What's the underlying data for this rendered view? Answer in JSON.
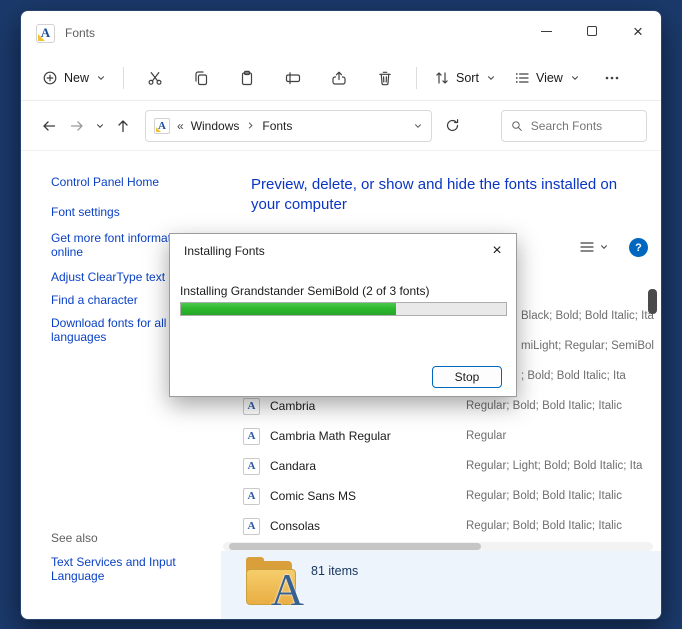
{
  "colors": {
    "desktop_bg": "#1b3a6c",
    "accent_blue": "#0067c0",
    "link_blue": "#0a41c4",
    "heading_blue": "#0a34c4",
    "progress_green": "#2db82d"
  },
  "window": {
    "title": "Fonts"
  },
  "toolbar": {
    "new_label": "New",
    "sort_label": "Sort",
    "view_label": "View"
  },
  "address_bar": {
    "breadcrumb_prefix": "«",
    "crumbs": [
      "Windows",
      "Fonts"
    ],
    "search_placeholder": "Search Fonts"
  },
  "sidebar": {
    "links": [
      "Control Panel Home",
      "Font settings",
      "Get more font information online",
      "Adjust ClearType text",
      "Find a character",
      "Download fonts for all languages"
    ],
    "see_also_label": "See also",
    "see_also_links": [
      "Text Services and Input Language"
    ]
  },
  "main": {
    "heading": "Preview, delete, or show and hide the fonts installed on your computer",
    "font_list": [
      {
        "name": "",
        "styles": "Black; Bold; Bold Italic; Ita",
        "clipped": true
      },
      {
        "name": "",
        "styles": "miLight; Regular; SemiBol",
        "clipped": true
      },
      {
        "name": "",
        "styles": "; Bold; Bold Italic; Ita",
        "clipped": true
      },
      {
        "name": "Cambria",
        "styles": "Regular; Bold; Bold Italic; Italic"
      },
      {
        "name": "Cambria Math Regular",
        "styles": "Regular"
      },
      {
        "name": "Candara",
        "styles": "Regular; Light; Bold; Bold Italic; Ita"
      },
      {
        "name": "Comic Sans MS",
        "styles": "Regular; Bold; Bold Italic; Italic"
      },
      {
        "name": "Consolas",
        "styles": "Regular; Bold; Bold Italic; Italic"
      }
    ],
    "status_text": "81 items"
  },
  "dialog": {
    "title": "Installing Fonts",
    "message": "Installing Grandstander SemiBold (2 of 3 fonts)",
    "progress_percent": 66,
    "stop_label": "Stop"
  },
  "icons": {
    "app": "A",
    "help": "?"
  }
}
